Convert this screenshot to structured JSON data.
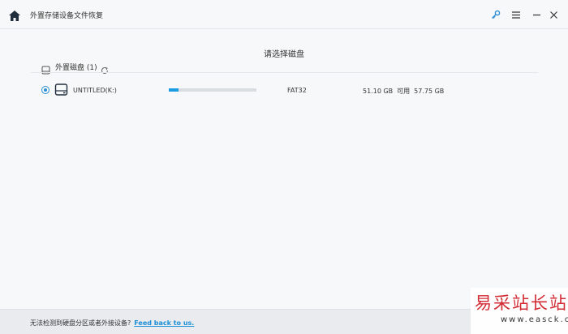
{
  "window": {
    "title": "外置存储设备文件恢复",
    "icons": {
      "home": "home-icon",
      "key": "key-icon",
      "menu": "menu-icon",
      "minimize": "minimize-icon",
      "close": "close-icon"
    },
    "accent_color": "#2b8fd6"
  },
  "main": {
    "heading": "请选择磁盘",
    "group": {
      "label": "外置磁盘 (1)",
      "icon": "external-drive-icon",
      "refresh_icon": "refresh-icon"
    },
    "disks": [
      {
        "selected": true,
        "name": "UNTITLED(K:)",
        "used_fraction": 0.11,
        "filesystem": "FAT32",
        "free": "51.10 GB",
        "free_label": "可用",
        "total": "57.75 GB"
      }
    ]
  },
  "footer": {
    "message": "无法检测到硬盘分区或者外接设备?",
    "link": "Feed back to us."
  },
  "watermark": {
    "main": "易采站长站",
    "sub": "www.easck.com"
  }
}
